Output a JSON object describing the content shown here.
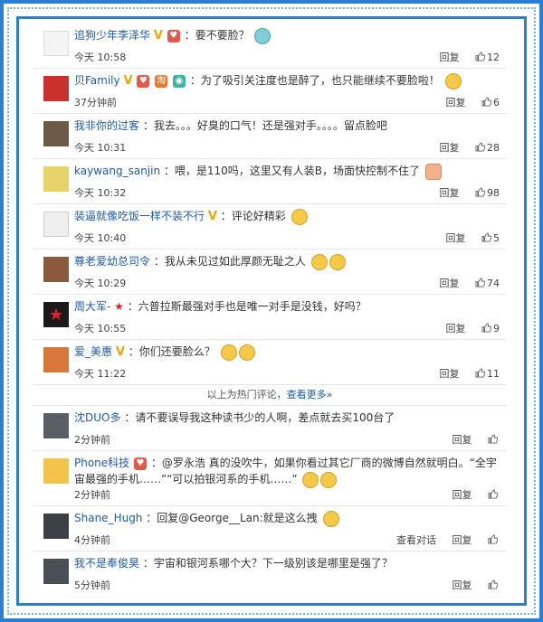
{
  "comments": [
    {
      "user": "追狗少年李泽华",
      "badges": [
        "v",
        "gift"
      ],
      "text": "：要不要脸？",
      "time": "今天 10:58",
      "reply": "回复",
      "likes": "12"
    },
    {
      "user": "贝Family",
      "badges": [
        "v",
        "gift",
        "shop",
        "camera"
      ],
      "text": "：为了吸引关注度也是醉了，也只能继续不要脸啦！",
      "time": "37分钟前",
      "reply": "回复",
      "likes": "6"
    },
    {
      "user": "我非你的过客",
      "badges": [],
      "text": "：我去。。。好臭的口气！还是强对手。。。。留点脸吧",
      "time": "今天 10:31",
      "reply": "回复",
      "likes": "28"
    },
    {
      "user": "kaywang_sanjin",
      "badges": [],
      "text": "：喂，是110吗，这里又有人装B，场面快控制不住了",
      "time": "今天 10:32",
      "reply": "回复",
      "likes": "98"
    },
    {
      "user": "装逼就像吃饭一样不装不行",
      "badges": [
        "v"
      ],
      "text": "：评论好精彩",
      "time": "今天 10:40",
      "reply": "回复",
      "likes": "5"
    },
    {
      "user": "尊老爱幼总司令",
      "badges": [],
      "text": "：我从未见过如此厚颜无耻之人",
      "time": "今天 10:29",
      "reply": "回复",
      "likes": "74"
    },
    {
      "user": "周大军-",
      "badges": [
        "star"
      ],
      "text": "：六普拉斯最强对手也是唯一对手是没钱，好吗？",
      "time": "今天 10:55",
      "reply": "回复",
      "likes": "9"
    },
    {
      "user": "爱_美惠",
      "badges": [
        "v"
      ],
      "text": "：你们还要脸么？",
      "time": "今天 11:22",
      "reply": "回复",
      "likes": "11"
    }
  ],
  "divider": {
    "text": "以上为热门评论，",
    "more": "查看更多»"
  },
  "recent": [
    {
      "user": "沈DUO多",
      "text": "：请不要误导我这种读书少的人啊，差点就去买100台了",
      "time": "2分钟前",
      "reply": "回复"
    },
    {
      "user": "Phone科技",
      "text": "：@罗永浩 真的没吹牛，如果你看过其它厂商的微博自然就明白。“全宇宙最强的手机……”“可以拍银河系的手机……”",
      "time": "2分钟前",
      "reply": "回复"
    },
    {
      "user": "Shane_Hugh",
      "text": "：回复@George__Lan:就是这么拽",
      "time": "4分钟前",
      "reply": "回复",
      "extra": "查看对话"
    },
    {
      "user": "我不是奉俊昊",
      "text": "：宇宙和银河系哪个大？下一级别该是哪里是强了？",
      "time": "5分钟前",
      "reply": "回复"
    }
  ],
  "colors": {
    "accent": "#2a7fd4",
    "link": "#1e5aa8"
  }
}
